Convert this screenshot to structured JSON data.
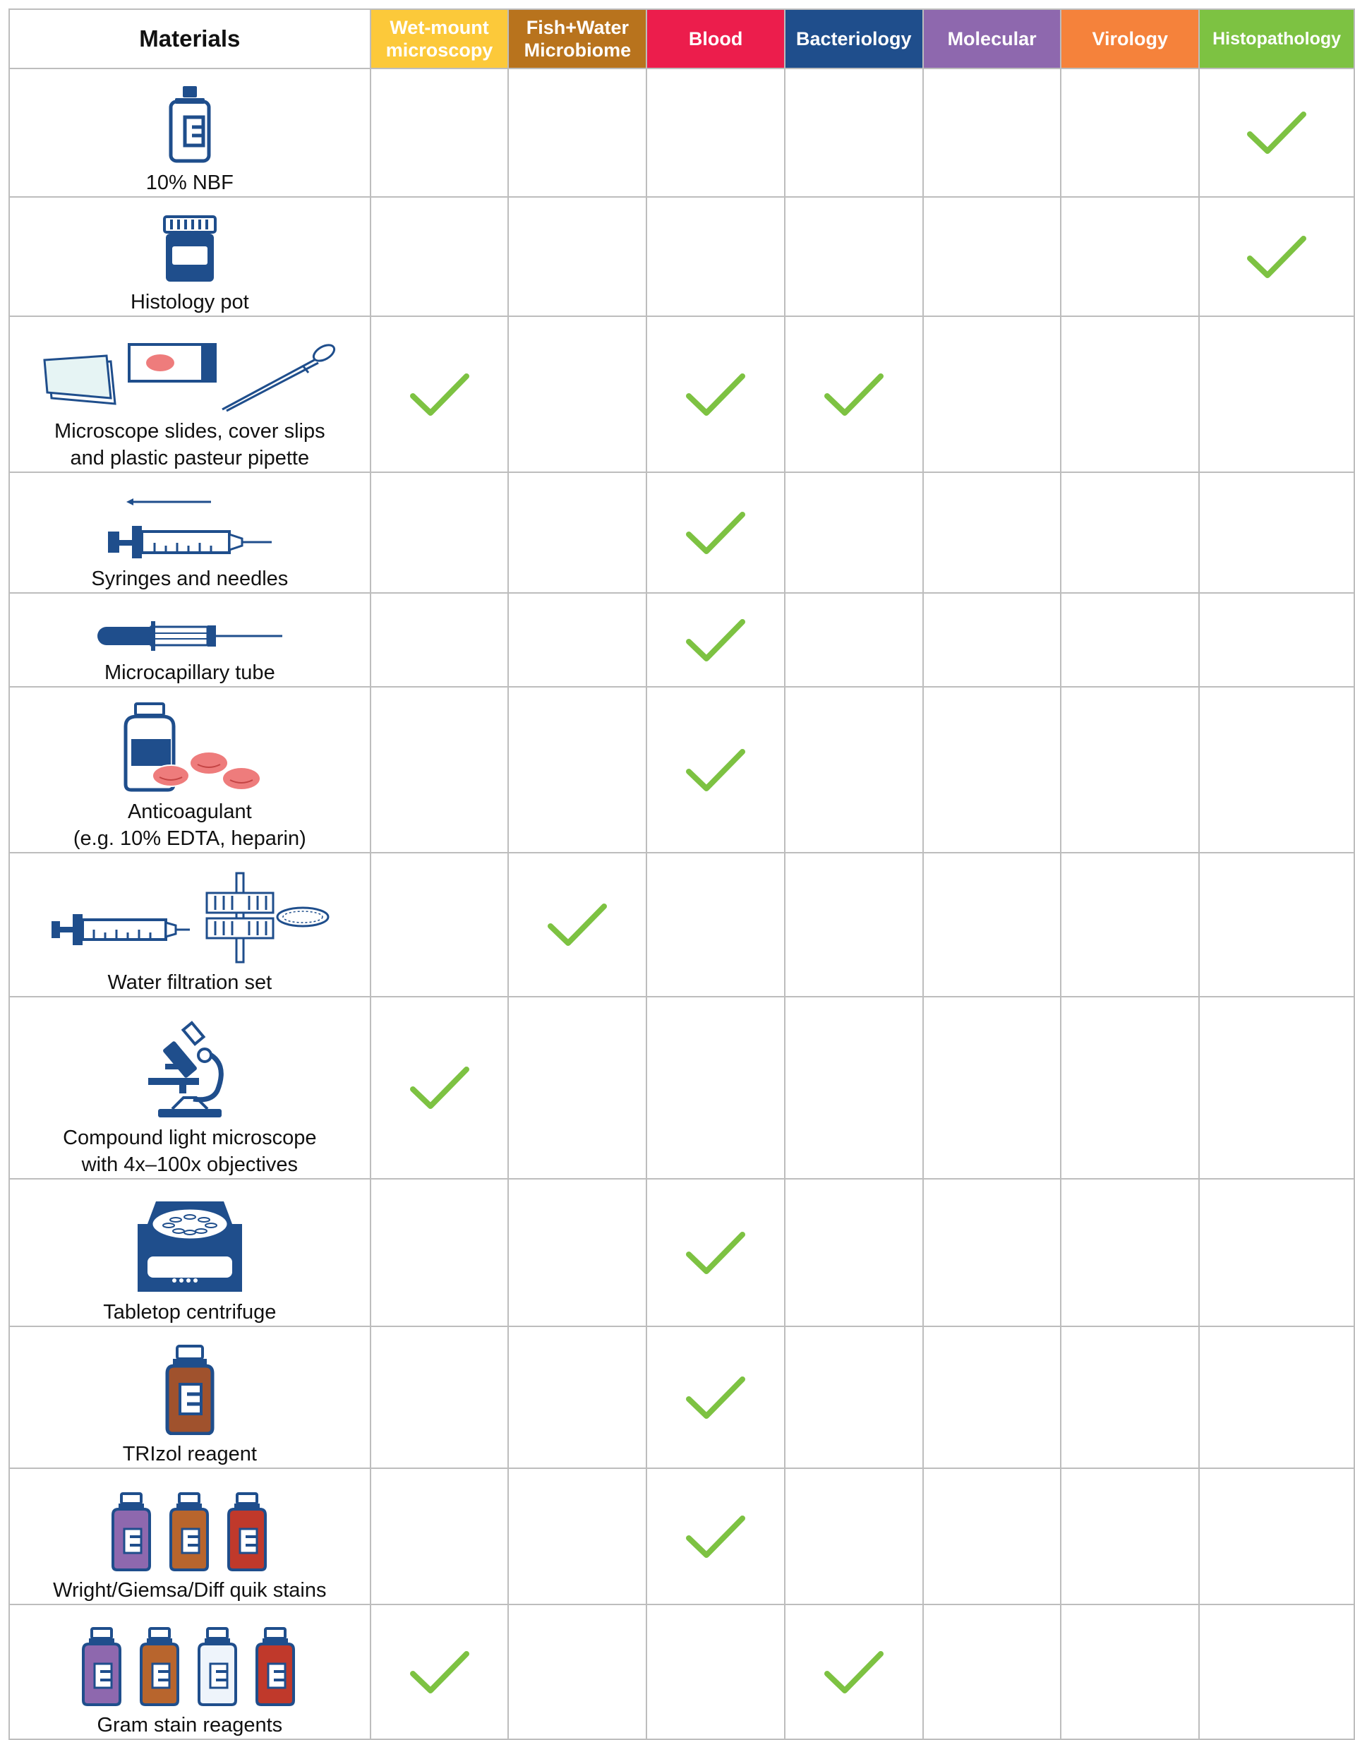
{
  "colors": {
    "navy": "#1f4e8c",
    "check": "#7dc242",
    "grid": "#bdbdbd",
    "pink": "#ee7c7c"
  },
  "header": {
    "materials": "Materials",
    "columns": [
      {
        "id": "wet",
        "lines": [
          "Wet-mount",
          "microscopy"
        ],
        "color": "#fcc93a"
      },
      {
        "id": "fish",
        "lines": [
          "Fish+Water",
          "Microbiome"
        ],
        "color": "#b8731d"
      },
      {
        "id": "blood",
        "lines": [
          "Blood"
        ],
        "color": "#ec1d4c"
      },
      {
        "id": "bact",
        "lines": [
          "Bacteriology"
        ],
        "color": "#1f4e8c"
      },
      {
        "id": "mol",
        "lines": [
          "Molecular"
        ],
        "color": "#8e68ae"
      },
      {
        "id": "viro",
        "lines": [
          "Virology"
        ],
        "color": "#f5823b"
      },
      {
        "id": "histo",
        "lines": [
          "Histopathology"
        ],
        "color": "#7dc242"
      }
    ]
  },
  "rows": [
    {
      "icon": "formalin-bottle-icon",
      "label": [
        "10% NBF"
      ],
      "checks": [
        false,
        false,
        false,
        false,
        false,
        false,
        true
      ]
    },
    {
      "icon": "histology-pot-icon",
      "label": [
        "Histology pot"
      ],
      "checks": [
        false,
        false,
        false,
        false,
        false,
        false,
        true
      ]
    },
    {
      "icon": "slides-pipette-icon",
      "label": [
        "Microscope slides, cover slips",
        "and plastic pasteur pipette"
      ],
      "checks": [
        true,
        false,
        true,
        true,
        false,
        false,
        false
      ]
    },
    {
      "icon": "syringe-needle-icon",
      "label": [
        "Syringes and needles"
      ],
      "checks": [
        false,
        false,
        true,
        false,
        false,
        false,
        false
      ]
    },
    {
      "icon": "microcapillary-tube-icon",
      "label": [
        "Microcapillary tube"
      ],
      "checks": [
        false,
        false,
        true,
        false,
        false,
        false,
        false
      ]
    },
    {
      "icon": "anticoagulant-icon",
      "label": [
        "Anticoagulant",
        "(e.g. 10% EDTA, heparin)"
      ],
      "checks": [
        false,
        false,
        true,
        false,
        false,
        false,
        false
      ]
    },
    {
      "icon": "water-filtration-icon",
      "label": [
        "Water filtration set"
      ],
      "checks": [
        false,
        true,
        false,
        false,
        false,
        false,
        false
      ]
    },
    {
      "icon": "microscope-icon",
      "label": [
        "Compound light microscope",
        "with 4x–100x objectives"
      ],
      "checks": [
        true,
        false,
        false,
        false,
        false,
        false,
        false
      ]
    },
    {
      "icon": "centrifuge-icon",
      "label": [
        "Tabletop centrifuge"
      ],
      "checks": [
        false,
        false,
        true,
        false,
        false,
        false,
        false
      ]
    },
    {
      "icon": "trizol-bottle-icon",
      "label": [
        "TRIzol reagent"
      ],
      "checks": [
        false,
        false,
        true,
        false,
        false,
        false,
        false
      ]
    },
    {
      "icon": "stain-bottles-icon",
      "label": [
        "Wright/Giemsa/Diff quik stains"
      ],
      "checks": [
        false,
        false,
        true,
        false,
        false,
        false,
        false
      ]
    },
    {
      "icon": "gram-stain-bottles-icon",
      "label": [
        "Gram stain reagents"
      ],
      "checks": [
        true,
        false,
        false,
        true,
        false,
        false,
        false
      ]
    }
  ]
}
